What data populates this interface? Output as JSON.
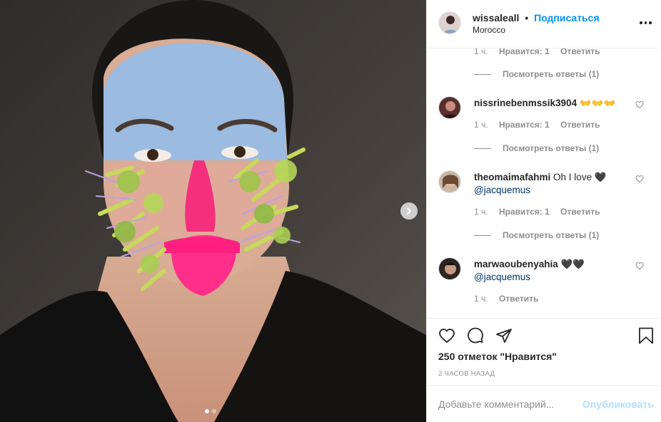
{
  "post": {
    "author": "wissaleall",
    "separator": "•",
    "follow_label": "Подписаться",
    "location": "Morocco",
    "more_icon": "more-horizontal-icon"
  },
  "carousel": {
    "next_icon": "chevron-right-icon",
    "slide_count": 2,
    "active_slide": 1
  },
  "comments": {
    "top_meta": {
      "time": "1 ч.",
      "likes": "Нравится: 1",
      "reply": "Ответить"
    },
    "top_view_replies": "Посмотреть ответы (1)",
    "items": [
      {
        "username": "nissrinebenmssik3904",
        "text": "👐👐👐",
        "time": "1 ч.",
        "likes": "Нравится: 1",
        "reply": "Ответить",
        "view_replies": "Посмотреть ответы (1)"
      },
      {
        "username": "theomaimafahmi",
        "text": "Oh I love 🖤",
        "mention": "@jacquemus",
        "time": "1 ч.",
        "likes": "Нравится: 1",
        "reply": "Ответить",
        "view_replies": "Посмотреть ответы (1)"
      },
      {
        "username": "marwaoubenyahia",
        "text": "🖤🖤",
        "mention": "@jacquemus",
        "time": "1 ч.",
        "reply": "Ответить"
      }
    ]
  },
  "actions": {
    "like_icon": "heart-icon",
    "comment_icon": "comment-icon",
    "share_icon": "share-icon",
    "save_icon": "bookmark-icon",
    "likes_text": "250 отметок \"Нравится\"",
    "posted_ago": "2 ЧАСОВ НАЗАД"
  },
  "add_comment": {
    "placeholder": "Добавьте комментарий...",
    "publish_label": "Опубликовать"
  },
  "colors": {
    "link_blue": "#0095f6",
    "publish_disabled": "#b2dffc",
    "mention_blue": "#00376b",
    "muted": "#8e8e8e"
  }
}
